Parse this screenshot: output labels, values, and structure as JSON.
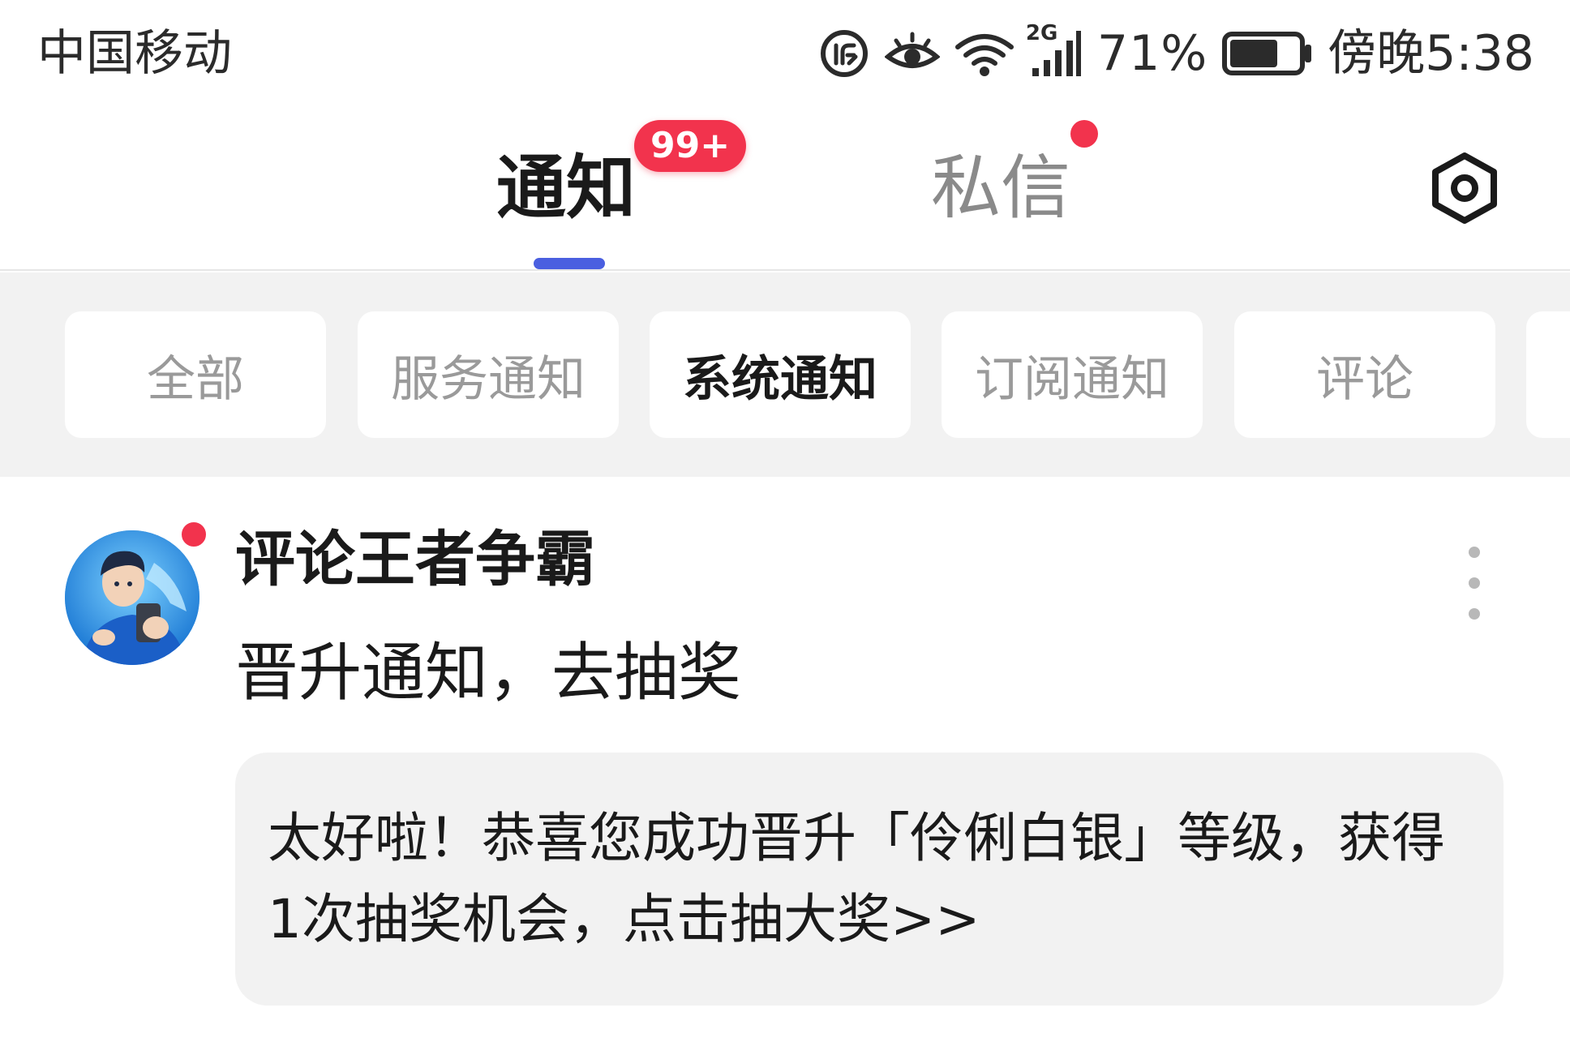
{
  "status_bar": {
    "carrier": "中国移动",
    "network": "2G",
    "battery_percent": "71%",
    "time": "傍晚5:38",
    "icons": [
      "data-saver-icon",
      "eye-protection-icon",
      "wifi-icon",
      "cellular-signal-icon",
      "battery-icon"
    ],
    "battery_level": 0.71
  },
  "tabs": {
    "notify_label": "通知",
    "notify_badge": "99+",
    "dm_label": "私信",
    "settings_icon": "settings-hexagon-icon"
  },
  "categories": [
    {
      "label": "全部",
      "active": false
    },
    {
      "label": "服务通知",
      "active": false
    },
    {
      "label": "系统通知",
      "active": true
    },
    {
      "label": "订阅通知",
      "active": false
    },
    {
      "label": "评论",
      "active": false
    }
  ],
  "notification": {
    "sender": "评论王者争霸",
    "subtitle": "晋升通知，去抽奖",
    "body": "太好啦！恭喜您成功晋升「伶俐白银」等级，获得1次抽奖机会，点击抽大奖>>",
    "more_icon": "more-vertical-icon"
  },
  "colors": {
    "accent_red": "#f2334d",
    "indicator_blue": "#4a5fe0",
    "chip_bar_bg": "#f2f2f2"
  }
}
